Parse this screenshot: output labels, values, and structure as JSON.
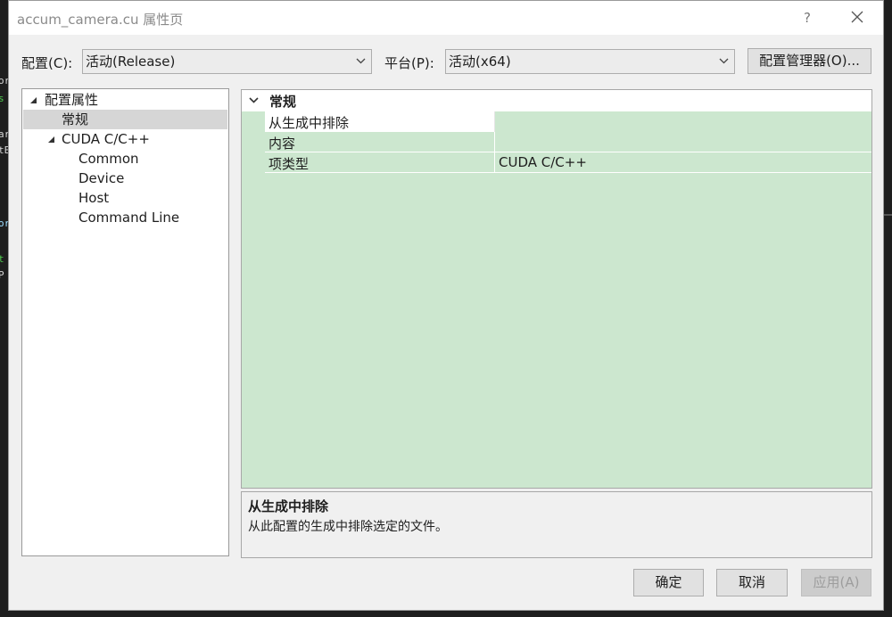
{
  "window": {
    "title": "accum_camera.cu 属性页",
    "help_label": "?"
  },
  "config": {
    "label": "配置(C):",
    "value": "活动(Release)"
  },
  "platform": {
    "label": "平台(P):",
    "value": "活动(x64)"
  },
  "config_manager_label": "配置管理器(O)...",
  "tree": {
    "items": [
      {
        "label": "配置属性"
      },
      {
        "label": "常规"
      },
      {
        "label": "CUDA C/C++"
      },
      {
        "label": "Common"
      },
      {
        "label": "Device"
      },
      {
        "label": "Host"
      },
      {
        "label": "Command Line"
      }
    ]
  },
  "grid": {
    "category": "常规",
    "rows": [
      {
        "name": "从生成中排除",
        "value": ""
      },
      {
        "name": "内容",
        "value": ""
      },
      {
        "name": "项类型",
        "value": "CUDA C/C++"
      }
    ]
  },
  "description": {
    "title": "从生成中排除",
    "text": "从此配置的生成中排除选定的文件。"
  },
  "buttons": {
    "ok": "确定",
    "cancel": "取消",
    "apply": "应用(A)"
  },
  "background_code": [
    "or",
    "s",
    "ar",
    "tE",
    "or",
    "t",
    "P"
  ],
  "colors": {
    "grid_background": "#cce7cf",
    "selection": "#d6d6d6",
    "dialog_background": "#f0f0f0"
  }
}
